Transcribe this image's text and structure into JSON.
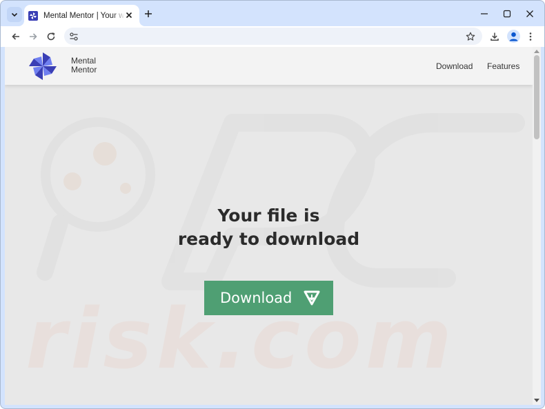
{
  "browser": {
    "tab": {
      "title": "Mental Mentor | Your way to happiness",
      "favicon": "pinwheel-icon",
      "close_icon": "close-icon"
    },
    "tab_search_icon": "chevron-down-icon",
    "new_tab_icon": "plus-icon",
    "window_controls": [
      "minimize-icon",
      "maximize-icon",
      "close-icon"
    ],
    "toolbar": {
      "back_icon": "arrow-left-icon",
      "forward_icon": "arrow-right-icon",
      "reload_icon": "reload-icon",
      "site_info_icon": "tune-icon",
      "address_value": "",
      "bookmark_icon": "star-icon",
      "downloads_icon": "download-icon",
      "profile_icon": "person-icon",
      "menu_icon": "more-vertical-icon"
    }
  },
  "site": {
    "brand": {
      "line1": "Mental",
      "line2": "Mentor",
      "logo_icon": "pinwheel-logo"
    },
    "nav": {
      "download": "Download",
      "features": "Features"
    },
    "hero": {
      "line1": "Your file is",
      "line2": "ready to download"
    },
    "download_button": {
      "label": "Download",
      "icon": "triangle-down-arrow-icon"
    },
    "watermark_text": "PC risk.com"
  },
  "colors": {
    "browser_frame": "#d3e3fd",
    "page_background": "#e8e8e8",
    "header_background": "#f3f3f3",
    "button_green": "#4f9f73",
    "logo_blue": "#3a3fb5"
  }
}
